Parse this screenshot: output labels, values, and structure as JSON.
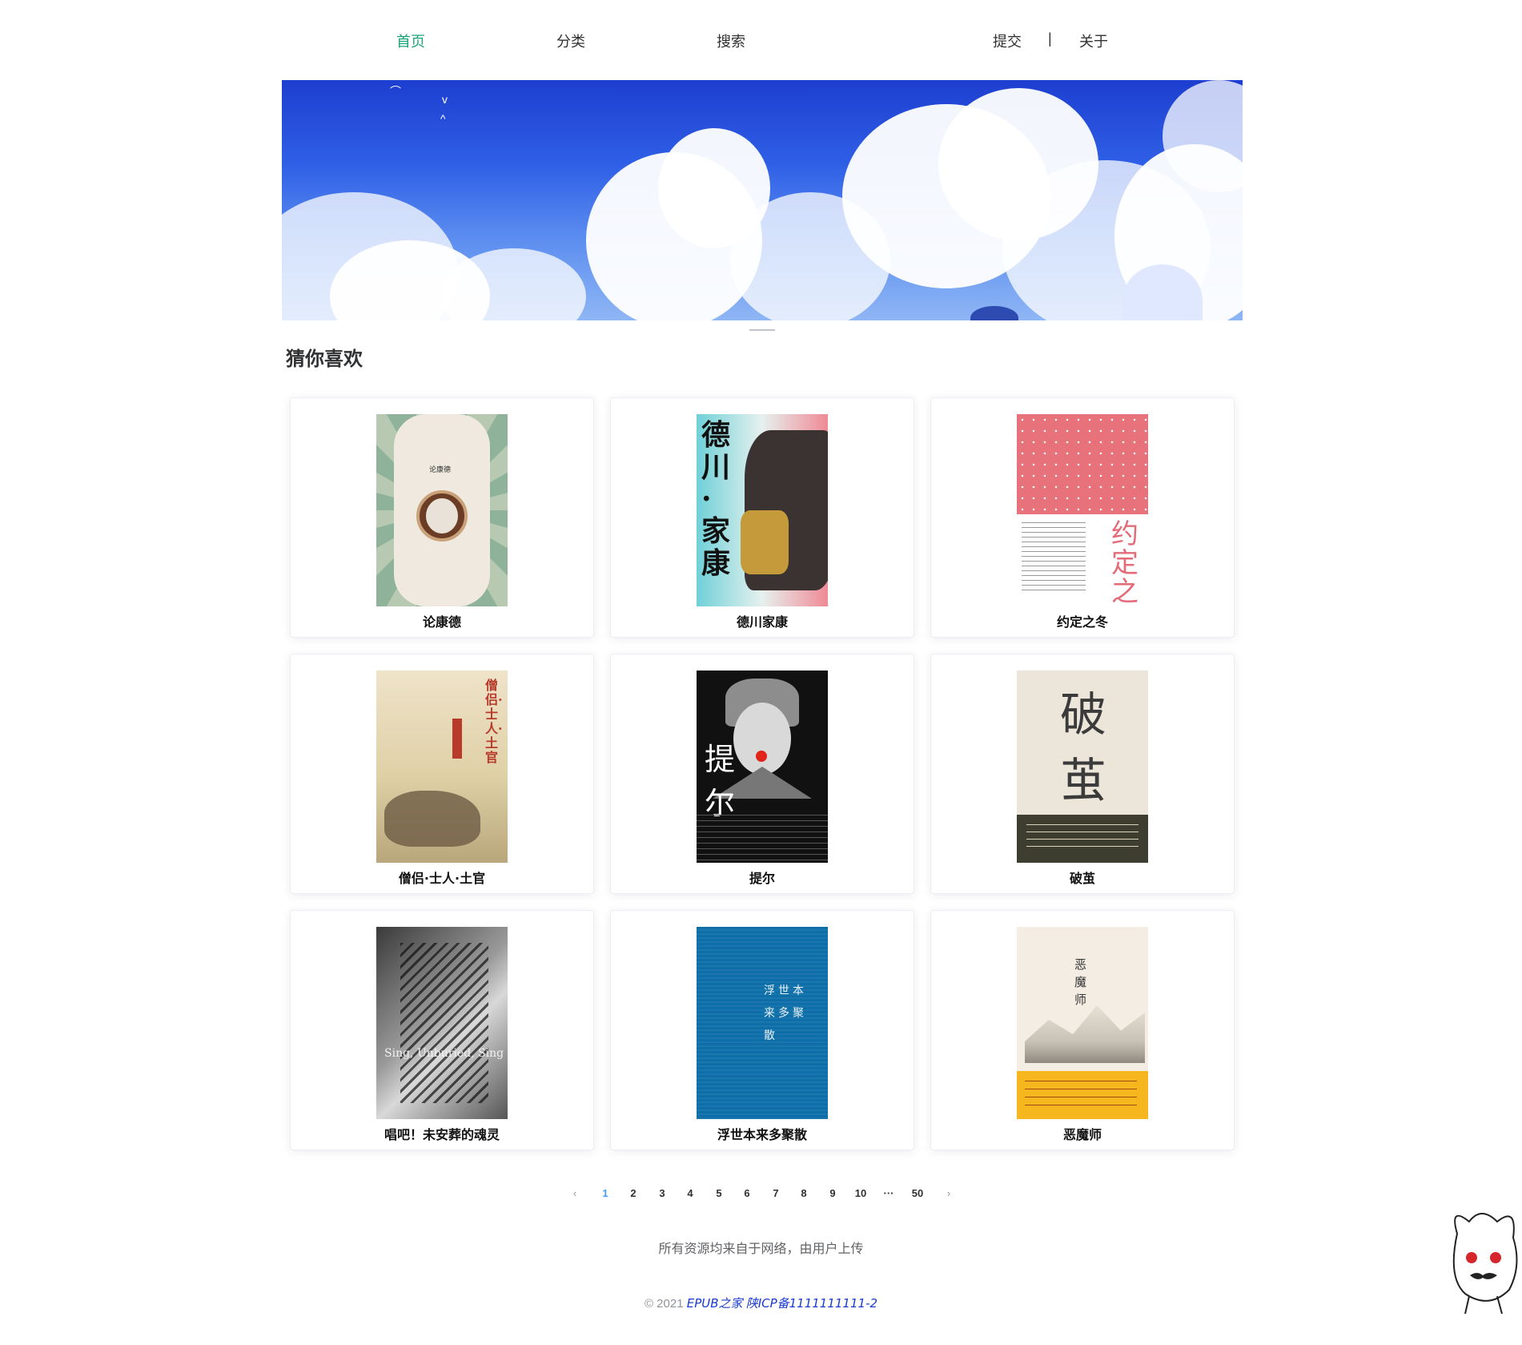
{
  "nav": {
    "items": [
      {
        "label": "首页"
      },
      {
        "label": "分类"
      },
      {
        "label": "搜索"
      },
      {
        "label": "提交"
      },
      {
        "label": "关于"
      }
    ],
    "separator": "|"
  },
  "section": {
    "title": "猜你喜欢"
  },
  "books": [
    {
      "title": "论康德",
      "cover_text": "论康德"
    },
    {
      "title": "德川家康",
      "cover_text": "德川·家康"
    },
    {
      "title": "约定之冬",
      "cover_text": "约定之冬"
    },
    {
      "title": "僧侣·士人·土官",
      "cover_text": "僧侣·士人·土官"
    },
    {
      "title": "提尔",
      "cover_text": "提 尔"
    },
    {
      "title": "破茧",
      "cover_text": "破茧"
    },
    {
      "title": "唱吧！未安葬的魂灵",
      "cover_text": "Sing, Unburied, Sing"
    },
    {
      "title": "浮世本来多聚散",
      "cover_text": "浮世本来多聚散"
    },
    {
      "title": "恶魔师",
      "cover_text": "恶魔师"
    }
  ],
  "pagination": {
    "prev": "‹",
    "pages": [
      "1",
      "2",
      "3",
      "4",
      "5",
      "6",
      "7",
      "8",
      "9",
      "10",
      "···",
      "50"
    ],
    "current": "1",
    "next": "›"
  },
  "footer": {
    "notice": "所有资源均来自于网络，由用户上传",
    "copyright": "© 2021",
    "site_link": "EPUB之家",
    "icp_link": "陕ICP备1111111111-2"
  },
  "colors": {
    "accent": "#1aa474",
    "page_current": "#409eff",
    "link": "#1a3ad1"
  }
}
